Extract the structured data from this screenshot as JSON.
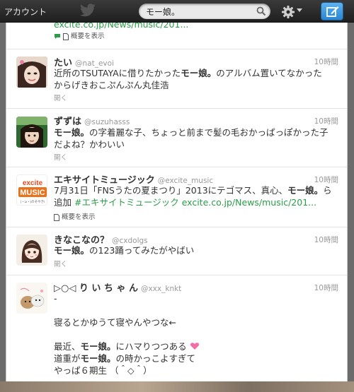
{
  "topbar": {
    "account_label": "アカウント",
    "search_value": "モー娘。"
  },
  "tweets": [
    {
      "partial": true,
      "link_text": "excite.co.jp/News/music/201...",
      "summary_label": "概要を表示"
    },
    {
      "name": "たい",
      "handle": "@nat_evoi",
      "time": "10時間",
      "line1_pre": "近所のTSUTAYAに借りたかった",
      "line1_bold": "モー娘。",
      "line1_post": "のアルバム置いてなかった",
      "line2": "からげきおこぷんぷん丸佳浩",
      "expand": "開く"
    },
    {
      "name": "ずずは",
      "handle": "@suzuhasss",
      "time": "10時間",
      "line1_bold": "モー娘。",
      "line1_post": "の字着麗な子、ちょっと前まで髪の毛おかっぱっぽかった子",
      "line2": "だよね？かわいい",
      "expand": "開く"
    },
    {
      "name": "エキサイトミュージック",
      "handle": "@excite_music",
      "time": "10時間",
      "line1_pre": "7月31日「FNSうたの夏まつり」2013にテゴマス、真心、",
      "line1_bold": "モー娘。",
      "line1_post": "ら",
      "line2_pre": "追加 ",
      "line2_hashtag": "#エキサイトミュージック",
      "line2_link": " excite.co.jp/News/music/201...",
      "summary_label": "概要を表示",
      "avatar_logo_top": "excite",
      "avatar_logo_mid": "MUSIC",
      "avatar_logo_bot": "(・ω・)のぞやき!"
    },
    {
      "name": "きなこなの？",
      "handle": "@cxdolgs",
      "time": "10時間",
      "line1_bold": "モー娘。",
      "line1_post": "の123踊ってみたがやばい",
      "expand": "開く"
    },
    {
      "name": "▷○◁ り い ち ゃ ん",
      "handle": "@xxx_knkt",
      "time": "10時間",
      "lines": [
        "-",
        "",
        "寝るとかゆうて寝やんやつな←",
        "",
        "最近、",
        "道重が",
        "やっぱ６期生 （＾◇＾）"
      ],
      "recent_bold": "モー娘。",
      "recent_post": "にハマりつつある",
      "michi_bold": "モー娘。",
      "michi_post": "の時かっこよすぎて"
    }
  ],
  "colors": {
    "link": "#2b7bb9",
    "text": "#333333",
    "meta": "#999999",
    "compose_button": "#2a86d3"
  }
}
